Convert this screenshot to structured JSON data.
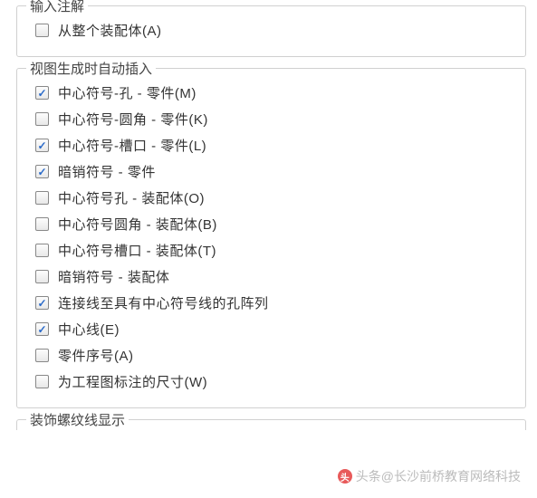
{
  "groups": [
    {
      "title": "输入注解",
      "options": [
        {
          "label": "从整个装配体(A)",
          "checked": false
        }
      ]
    },
    {
      "title": "视图生成时自动插入",
      "options": [
        {
          "label": "中心符号-孔 - 零件(M)",
          "checked": true
        },
        {
          "label": "中心符号-圆角  - 零件(K)",
          "checked": false
        },
        {
          "label": "中心符号-槽口 - 零件(L)",
          "checked": true
        },
        {
          "label": "暗销符号 - 零件",
          "checked": true
        },
        {
          "label": "中心符号孔 - 装配体(O)",
          "checked": false
        },
        {
          "label": "中心符号圆角 - 装配体(B)",
          "checked": false
        },
        {
          "label": "中心符号槽口 - 装配体(T)",
          "checked": false
        },
        {
          "label": "暗销符号 - 装配体",
          "checked": false
        },
        {
          "label": "连接线至具有中心符号线的孔阵列",
          "checked": true
        },
        {
          "label": "中心线(E)",
          "checked": true
        },
        {
          "label": "零件序号(A)",
          "checked": false
        },
        {
          "label": "为工程图标注的尺寸(W)",
          "checked": false
        }
      ]
    }
  ],
  "truncated_group_title": "装饰螺纹线显示",
  "watermark": "头条@长沙前桥教育网络科技"
}
